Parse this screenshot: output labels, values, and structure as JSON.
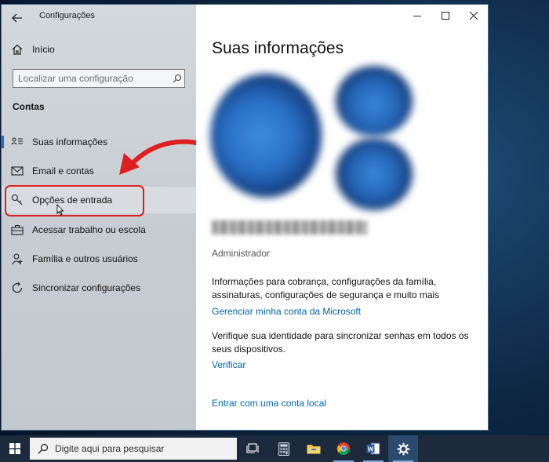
{
  "window": {
    "title": "Configurações",
    "controls": {
      "minimize": "minimize",
      "maximize": "maximize",
      "close": "close"
    }
  },
  "sidebar": {
    "home_label": "Início",
    "search": {
      "placeholder": "Localizar uma configuração",
      "value": ""
    },
    "section_title": "Contas",
    "items": [
      {
        "label": "Suas informações",
        "icon": "person-card-icon",
        "selected": true
      },
      {
        "label": "Email e contas",
        "icon": "mail-icon"
      },
      {
        "label": "Opções de entrada",
        "icon": "key-icon",
        "highlighted": true
      },
      {
        "label": "Acessar trabalho ou escola",
        "icon": "briefcase-icon"
      },
      {
        "label": "Família e outros usuários",
        "icon": "people-icon"
      },
      {
        "label": "Sincronizar configurações",
        "icon": "sync-icon"
      }
    ]
  },
  "main": {
    "title": "Suas informações",
    "account_type": "Administrador",
    "billing_text": "Informações para cobrança, configurações da família, assinaturas, configurações de segurança e muito mais",
    "manage_link": "Gerenciar minha conta da Microsoft",
    "verify_text": "Verifique sua identidade para sincronizar senhas em todos os seus dispositivos.",
    "verify_link": "Verificar",
    "local_account_link": "Entrar com uma conta local"
  },
  "annotation": {
    "highlight_color": "#e02020"
  },
  "taskbar": {
    "search_placeholder": "Digite aqui para pesquisar",
    "icons": [
      "task-view-icon",
      "calculator-icon",
      "file-explorer-icon",
      "chrome-icon",
      "word-icon",
      "settings-icon"
    ]
  },
  "colors": {
    "accent": "#2467c4",
    "link": "#0063b1",
    "taskbar": "#1c2a3c"
  }
}
